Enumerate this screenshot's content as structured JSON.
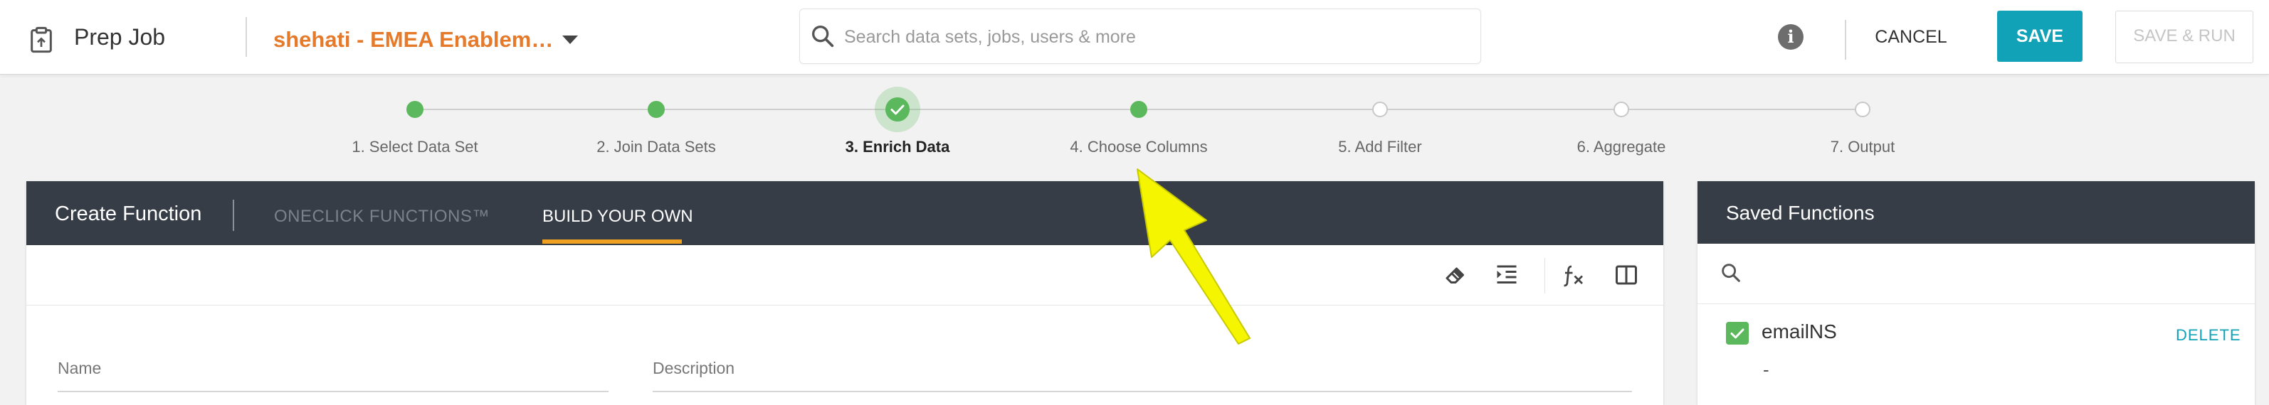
{
  "topbar": {
    "app_title": "Prep Job",
    "project_name": "shehati - EMEA Enablem…",
    "search_placeholder": "Search data sets, jobs, users & more",
    "info_glyph": "i",
    "cancel_label": "CANCEL",
    "save_label": "SAVE",
    "save_run_label": "SAVE & RUN",
    "icons": {
      "app": "clipboard-icon",
      "search": "search-icon",
      "info": "info-icon",
      "dropdown": "chevron-down-icon"
    },
    "colors": {
      "project": "#e57a2b",
      "save_button": "#12a2b8"
    }
  },
  "stepper": {
    "steps": [
      {
        "label": "1. Select Data Set",
        "status": "completed"
      },
      {
        "label": "2. Join Data Sets",
        "status": "completed"
      },
      {
        "label": "3. Enrich Data",
        "status": "current"
      },
      {
        "label": "4. Choose Columns",
        "status": "completed"
      },
      {
        "label": "5. Add Filter",
        "status": "pending"
      },
      {
        "label": "6. Aggregate",
        "status": "pending"
      },
      {
        "label": "7. Output",
        "status": "pending"
      }
    ],
    "colors": {
      "done": "#5cb85c",
      "pending_border": "#c8c8c8"
    }
  },
  "create_function": {
    "title": "Create Function",
    "tabs": [
      {
        "label": "ONECLICK FUNCTIONS™",
        "active": false
      },
      {
        "label": "BUILD YOUR OWN",
        "active": true
      }
    ],
    "toolbar_icons": [
      "eraser-icon",
      "indent-icon",
      "function-icon",
      "split-view-icon"
    ],
    "fields": {
      "name_label": "Name",
      "description_label": "Description"
    },
    "colors": {
      "header": "#363d47",
      "tab_underline": "#f0a020"
    }
  },
  "saved_functions": {
    "title": "Saved Functions",
    "items": [
      {
        "name": "emailNS",
        "checked": true,
        "delete_label": "DELETE",
        "description": "-"
      }
    ],
    "icons": {
      "search": "search-icon",
      "checkbox": "checkbox-checked-icon"
    }
  },
  "annotation": {
    "arrow_color": "#f5f500",
    "arrow_icon": "pointer-arrow-icon"
  }
}
